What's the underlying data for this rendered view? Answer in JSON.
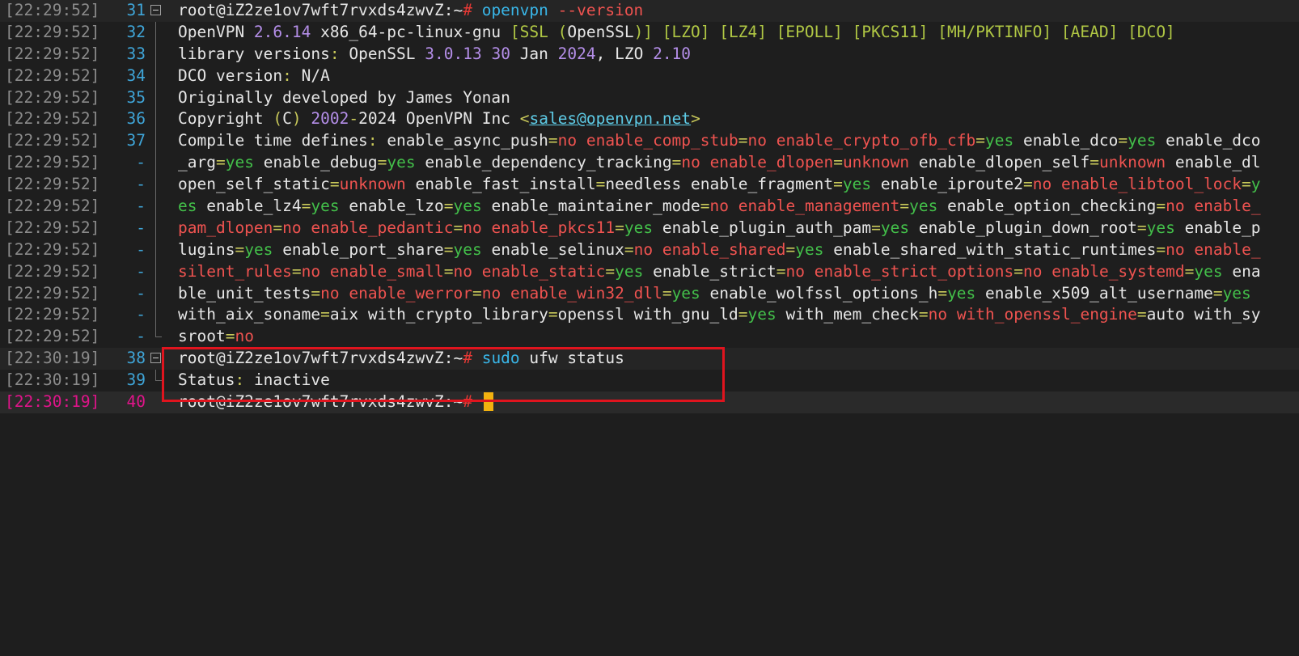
{
  "colors": {
    "background": "#1e1e1e",
    "timestamp": "#8b8b8b",
    "line_number": "#3fa5d8",
    "active_line": "#e0148a",
    "yes": "#43c04a",
    "no": "#ef5350",
    "number": "#b48ee8",
    "cursor": "#f2b10f",
    "highlight_box": "#e0141e"
  },
  "rows": [
    {
      "ts": "[22:29:52]",
      "ln": "31",
      "prompt": "root@iZ2ze1ov7wft7rvxds4zwvZ:~",
      "hash": "#",
      "cmd": "openvpn",
      "args": "--version"
    },
    {
      "ts": "[22:29:52]",
      "ln": "32"
    },
    {
      "ts": "[22:29:52]",
      "ln": "33"
    },
    {
      "ts": "[22:29:52]",
      "ln": "34"
    },
    {
      "ts": "[22:29:52]",
      "ln": "35"
    },
    {
      "ts": "[22:29:52]",
      "ln": "36"
    },
    {
      "ts": "[22:29:52]",
      "ln": "37"
    },
    {
      "ts": "[22:29:52]",
      "ln": "-"
    },
    {
      "ts": "[22:29:52]",
      "ln": "-"
    },
    {
      "ts": "[22:29:52]",
      "ln": "-"
    },
    {
      "ts": "[22:29:52]",
      "ln": "-"
    },
    {
      "ts": "[22:29:52]",
      "ln": "-"
    },
    {
      "ts": "[22:29:52]",
      "ln": "-"
    },
    {
      "ts": "[22:29:52]",
      "ln": "-"
    },
    {
      "ts": "[22:29:52]",
      "ln": "-"
    },
    {
      "ts": "[22:29:52]",
      "ln": "-"
    },
    {
      "ts": "[22:30:19]",
      "ln": "38",
      "prompt": "root@iZ2ze1ov7wft7rvxds4zwvZ:~",
      "hash": "#",
      "cmd": "sudo",
      "args": "ufw status"
    },
    {
      "ts": "[22:30:19]",
      "ln": "39"
    },
    {
      "ts": "[22:30:19]",
      "ln": "40",
      "prompt": "root@iZ2ze1ov7wft7rvxds4zwvZ:~",
      "hash": "#"
    }
  ],
  "output": {
    "l32": {
      "a": "OpenVPN ",
      "ver": "2.6.14",
      "b": " x86_64-pc-linux-gnu ",
      "ssl": "[SSL",
      "p1": " (",
      "openssl": "OpenSSL",
      "p2": ")]",
      "lzo": " [LZO]",
      "lz4": " [LZ4]",
      "epoll": " [EPOLL]",
      "pkcs": " [PKCS11]",
      "mh": " [MH/PKTINFO]",
      "aead": " [AEAD]",
      "dco": " [DCO]"
    },
    "l33": {
      "a": "library versions",
      "colon": ":",
      "b": " OpenSSL ",
      "v1": "3.0.13",
      "sp": " ",
      "d1": "30",
      "c": " Jan ",
      "y1": "2024",
      "d": ", LZO ",
      "v2": "2.10"
    },
    "l34": {
      "a": "DCO version",
      "colon": ":",
      "b": " N/A"
    },
    "l35": {
      "a": "Originally developed by James Yonan"
    },
    "l36": {
      "a": "Copyright ",
      "p1": "(",
      "c": "C",
      "p2": ")",
      "sp": " ",
      "y1": "2002",
      "dash": "-",
      "y2": "2024",
      "b": " OpenVPN Inc ",
      "lt": "<",
      "email": "sales@openvpn.net",
      "gt": ">"
    },
    "l37": {
      "a": "Compile time defines",
      "colon": ":"
    },
    "status": {
      "label": "Status",
      "colon": ":",
      "value": " inactive"
    },
    "sroot": {
      "key": "sroot",
      "eq": "=",
      "val": "no"
    }
  }
}
